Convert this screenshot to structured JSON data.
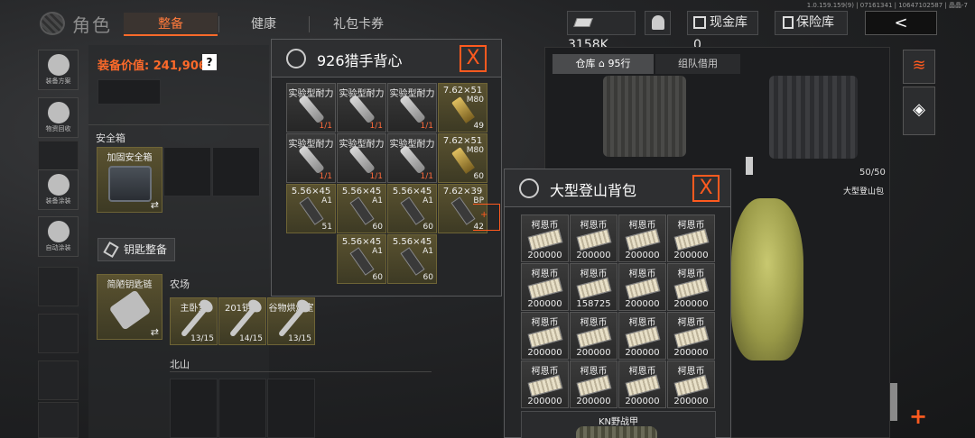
{
  "version": "1.0.159.159(9) | 07161341 | 10647102587 | 晶晶-7",
  "header": {
    "title": "角色",
    "tabs": [
      "整备",
      "健康",
      "礼包卡券"
    ],
    "currency": "3158K",
    "cash_stash": "现金库 0",
    "vault": "保险库",
    "back": "<"
  },
  "sidebar": [
    "装备方案",
    "物资回收",
    "装备涂装",
    "自动涂装"
  ],
  "loadout": {
    "value_label": "装备价值: 241,906",
    "help": "?",
    "safe_box_label": "安全箱",
    "safe_box_item": "加固安全箱",
    "keys_button": "钥匙整备",
    "keychain_item": "简陋钥匙链",
    "farm_label": "农场",
    "keys": [
      {
        "name": "主卧室",
        "count": "13/15"
      },
      {
        "name": "201钥匙",
        "count": "14/15"
      },
      {
        "name": "谷物烘烤室",
        "count": "13/15"
      }
    ],
    "north_label": "北山"
  },
  "vest_popup": {
    "title": "926猎手背心",
    "close": "X",
    "items": [
      {
        "name": "实验型耐力",
        "count": "1/1",
        "kind": "syringe"
      },
      {
        "name": "实验型耐力",
        "count": "1/1",
        "kind": "syringe"
      },
      {
        "name": "实验型耐力",
        "count": "1/1",
        "kind": "syringe"
      },
      {
        "name": "7.62×51",
        "sub": "M80",
        "count": "49",
        "kind": "ammo"
      },
      {
        "name": "实验型耐力",
        "count": "1/1",
        "kind": "syringe"
      },
      {
        "name": "实验型耐力",
        "count": "1/1",
        "kind": "syringe"
      },
      {
        "name": "实验型耐力",
        "count": "1/1",
        "kind": "syringe"
      },
      {
        "name": "7.62×51",
        "sub": "M80",
        "count": "60",
        "kind": "ammo"
      },
      {
        "name": "5.56×45",
        "sub": "A1",
        "count": "51",
        "kind": "mag"
      },
      {
        "name": "5.56×45",
        "sub": "A1",
        "count": "60",
        "kind": "mag"
      },
      {
        "name": "5.56×45",
        "sub": "A1",
        "count": "60",
        "kind": "mag"
      },
      {
        "name": "7.62×39",
        "sub": "BP",
        "count": "42",
        "kind": "mag"
      },
      {
        "name": "5.56×45",
        "sub": "A1",
        "count": "60",
        "kind": "mag"
      },
      {
        "name": "5.56×45",
        "sub": "A1",
        "count": "60",
        "kind": "mag"
      }
    ]
  },
  "warehouse": {
    "tab_warehouse": "仓库",
    "rows": "95行",
    "tab_borrow": "组队借用",
    "capacity": "50/50",
    "bag_label": "大型登山包"
  },
  "bag_popup": {
    "title": "大型登山背包",
    "close": "X",
    "cash": [
      {
        "name": "柯恩币",
        "count": "200000"
      },
      {
        "name": "柯恩币",
        "count": "200000"
      },
      {
        "name": "柯恩币",
        "count": "200000"
      },
      {
        "name": "柯恩币",
        "count": "200000"
      },
      {
        "name": "柯恩币",
        "count": "200000"
      },
      {
        "name": "柯恩币",
        "count": "158725"
      },
      {
        "name": "柯恩币",
        "count": "200000"
      },
      {
        "name": "柯恩币",
        "count": "200000"
      },
      {
        "name": "柯恩币",
        "count": "200000"
      },
      {
        "name": "柯恩币",
        "count": "200000"
      },
      {
        "name": "柯恩币",
        "count": "200000"
      },
      {
        "name": "柯恩币",
        "count": "200000"
      },
      {
        "name": "柯恩币",
        "count": "200000"
      },
      {
        "name": "柯恩币",
        "count": "200000"
      },
      {
        "name": "柯恩币",
        "count": "200000"
      },
      {
        "name": "柯恩币",
        "count": "200000"
      }
    ],
    "bottom_item": "KN野战甲"
  },
  "add_button": "+",
  "colors": {
    "accent": "#ff6a2a",
    "slot": "#5a5230"
  }
}
